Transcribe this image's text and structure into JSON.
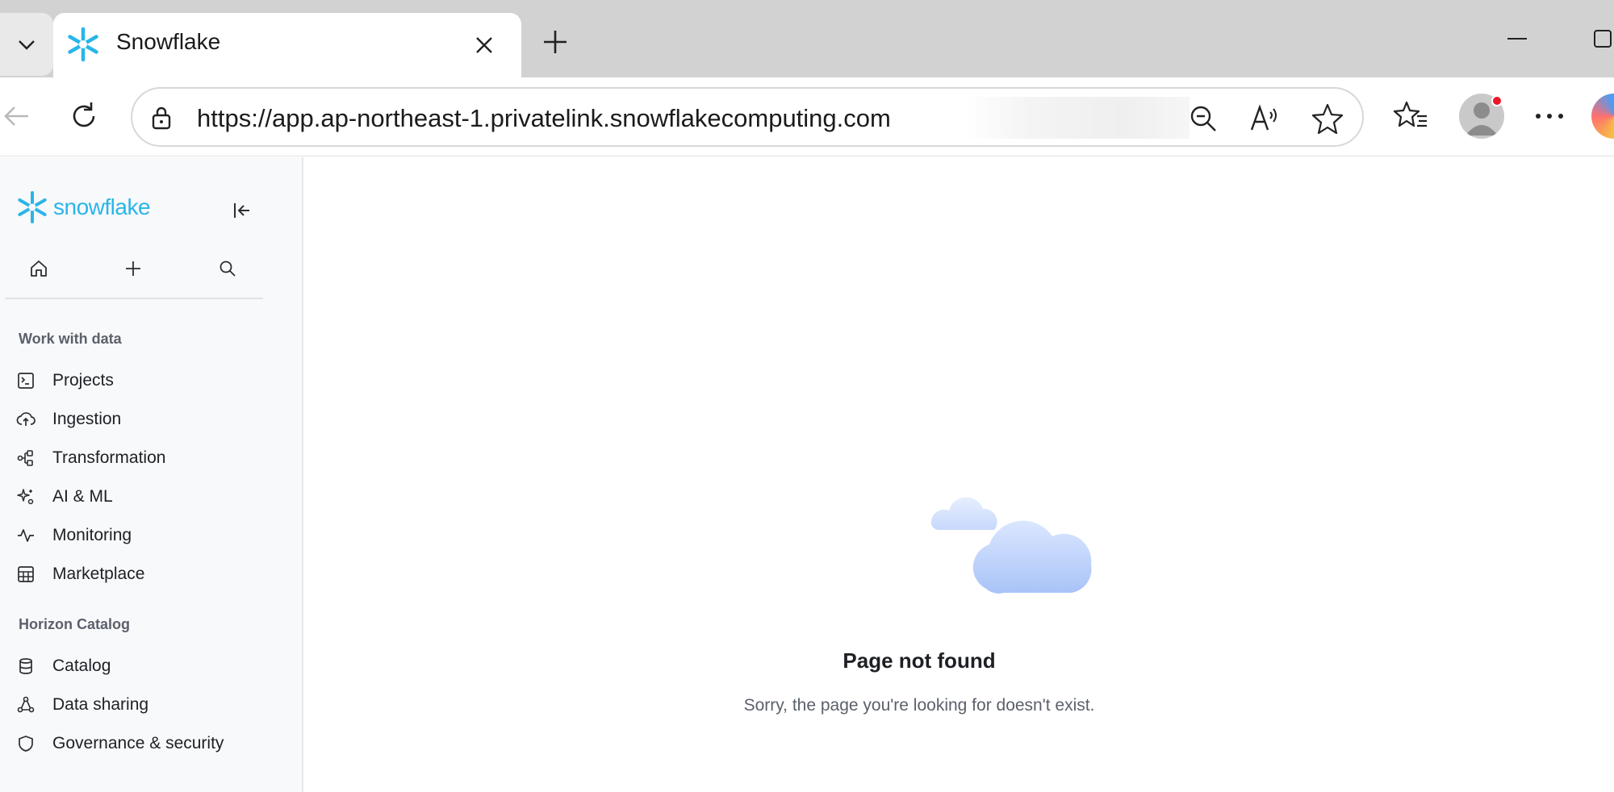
{
  "browser": {
    "tab_title": "Snowflake",
    "url": "https://app.ap-northeast-1.privatelink.snowflakecomputing.com",
    "icons": {
      "tab_menu": "chevron-down-icon",
      "tab_close": "close-icon",
      "new_tab": "plus-icon",
      "back": "back-arrow-icon",
      "refresh": "refresh-icon",
      "lock": "lock-icon",
      "zoom": "zoom-out-icon",
      "read_aloud": "read-aloud-icon",
      "favorite": "star-icon",
      "favorites": "favorites-icon",
      "profile": "profile-icon",
      "more": "more-icon"
    }
  },
  "sidebar": {
    "logo_text": "snowflake",
    "brand_color": "#29b5e8",
    "quick_actions": [
      "home-icon",
      "plus-icon",
      "search-icon"
    ],
    "sections": [
      {
        "title": "Work with data",
        "items": [
          {
            "label": "Projects",
            "icon": "projects-icon"
          },
          {
            "label": "Ingestion",
            "icon": "ingestion-icon"
          },
          {
            "label": "Transformation",
            "icon": "transformation-icon"
          },
          {
            "label": "AI & ML",
            "icon": "ai-ml-icon"
          },
          {
            "label": "Monitoring",
            "icon": "monitoring-icon"
          },
          {
            "label": "Marketplace",
            "icon": "marketplace-icon"
          }
        ]
      },
      {
        "title": "Horizon Catalog",
        "items": [
          {
            "label": "Catalog",
            "icon": "catalog-icon"
          },
          {
            "label": "Data sharing",
            "icon": "data-sharing-icon"
          },
          {
            "label": "Governance & security",
            "icon": "shield-icon"
          }
        ]
      }
    ]
  },
  "main": {
    "title": "Page not found",
    "subtitle": "Sorry, the page you're looking for doesn't exist."
  }
}
